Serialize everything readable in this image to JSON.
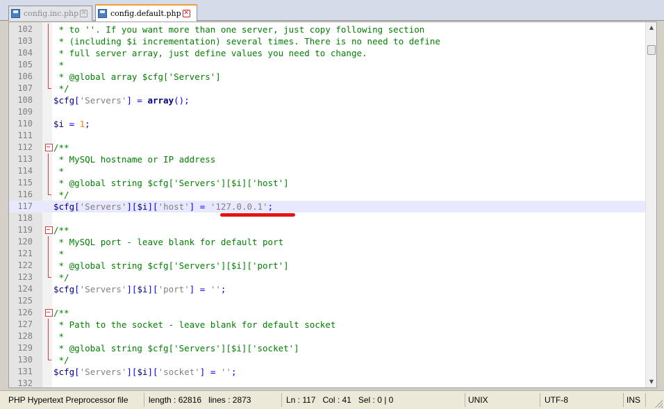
{
  "tabs": [
    {
      "label": "config.inc.php",
      "active": false
    },
    {
      "label": "config.default.php",
      "active": true
    }
  ],
  "editor": {
    "current_line": 117,
    "lines": [
      {
        "n": "102",
        "fold": "vline",
        "code": [
          [
            "c",
            " * to ''. If you want more than one server, just copy following section"
          ]
        ]
      },
      {
        "n": "103",
        "fold": "vline",
        "code": [
          [
            "c",
            " * (including $i incrementation) several times. There is no need to define"
          ]
        ]
      },
      {
        "n": "104",
        "fold": "vline",
        "code": [
          [
            "c",
            " * full server array, just define values you need to change."
          ]
        ]
      },
      {
        "n": "105",
        "fold": "vline",
        "code": [
          [
            "c",
            " *"
          ]
        ]
      },
      {
        "n": "106",
        "fold": "vline",
        "code": [
          [
            "c",
            " * @global array $cfg['Servers']"
          ]
        ]
      },
      {
        "n": "107",
        "fold": "end",
        "code": [
          [
            "c",
            " */"
          ]
        ]
      },
      {
        "n": "108",
        "fold": "",
        "code": [
          [
            "v",
            "$cfg"
          ],
          [
            "k",
            "["
          ],
          [
            "s",
            "'Servers'"
          ],
          [
            "k",
            "]"
          ],
          [
            "k",
            " = "
          ],
          [
            "kw",
            "array"
          ],
          [
            "k",
            "();"
          ]
        ]
      },
      {
        "n": "109",
        "fold": "",
        "code": []
      },
      {
        "n": "110",
        "fold": "",
        "code": [
          [
            "v",
            "$i"
          ],
          [
            "k",
            " = "
          ],
          [
            "n",
            "1"
          ],
          [
            "k",
            ";"
          ]
        ]
      },
      {
        "n": "111",
        "fold": "",
        "code": []
      },
      {
        "n": "112",
        "fold": "box",
        "code": [
          [
            "c",
            "/**"
          ]
        ]
      },
      {
        "n": "113",
        "fold": "vline",
        "code": [
          [
            "c",
            " * MySQL hostname or IP address"
          ]
        ]
      },
      {
        "n": "114",
        "fold": "vline",
        "code": [
          [
            "c",
            " *"
          ]
        ]
      },
      {
        "n": "115",
        "fold": "vline",
        "code": [
          [
            "c",
            " * @global string $cfg['Servers'][$i]['host']"
          ]
        ]
      },
      {
        "n": "116",
        "fold": "end",
        "code": [
          [
            "c",
            " */"
          ]
        ]
      },
      {
        "n": "117",
        "fold": "",
        "code": [
          [
            "v",
            "$cfg"
          ],
          [
            "k",
            "["
          ],
          [
            "s",
            "'Servers'"
          ],
          [
            "k",
            "]["
          ],
          [
            "v",
            "$i"
          ],
          [
            "k",
            "]["
          ],
          [
            "s",
            "'host'"
          ],
          [
            "k",
            "]"
          ],
          [
            "k",
            " = "
          ],
          [
            "s",
            "'127.0.0.1'"
          ],
          [
            "k",
            ";"
          ]
        ]
      },
      {
        "n": "118",
        "fold": "",
        "code": []
      },
      {
        "n": "119",
        "fold": "box",
        "code": [
          [
            "c",
            "/**"
          ]
        ]
      },
      {
        "n": "120",
        "fold": "vline",
        "code": [
          [
            "c",
            " * MySQL port - leave blank for default port"
          ]
        ]
      },
      {
        "n": "121",
        "fold": "vline",
        "code": [
          [
            "c",
            " *"
          ]
        ]
      },
      {
        "n": "122",
        "fold": "vline",
        "code": [
          [
            "c",
            " * @global string $cfg['Servers'][$i]['port']"
          ]
        ]
      },
      {
        "n": "123",
        "fold": "end",
        "code": [
          [
            "c",
            " */"
          ]
        ]
      },
      {
        "n": "124",
        "fold": "",
        "code": [
          [
            "v",
            "$cfg"
          ],
          [
            "k",
            "["
          ],
          [
            "s",
            "'Servers'"
          ],
          [
            "k",
            "]["
          ],
          [
            "v",
            "$i"
          ],
          [
            "k",
            "]["
          ],
          [
            "s",
            "'port'"
          ],
          [
            "k",
            "]"
          ],
          [
            "k",
            " = "
          ],
          [
            "s",
            "''"
          ],
          [
            "k",
            ";"
          ]
        ]
      },
      {
        "n": "125",
        "fold": "",
        "code": []
      },
      {
        "n": "126",
        "fold": "box",
        "code": [
          [
            "c",
            "/**"
          ]
        ]
      },
      {
        "n": "127",
        "fold": "vline",
        "code": [
          [
            "c",
            " * Path to the socket - leave blank for default socket"
          ]
        ]
      },
      {
        "n": "128",
        "fold": "vline",
        "code": [
          [
            "c",
            " *"
          ]
        ]
      },
      {
        "n": "129",
        "fold": "vline",
        "code": [
          [
            "c",
            " * @global string $cfg['Servers'][$i]['socket']"
          ]
        ]
      },
      {
        "n": "130",
        "fold": "end",
        "code": [
          [
            "c",
            " */"
          ]
        ]
      },
      {
        "n": "131",
        "fold": "",
        "code": [
          [
            "v",
            "$cfg"
          ],
          [
            "k",
            "["
          ],
          [
            "s",
            "'Servers'"
          ],
          [
            "k",
            "]["
          ],
          [
            "v",
            "$i"
          ],
          [
            "k",
            "]["
          ],
          [
            "s",
            "'socket'"
          ],
          [
            "k",
            "]"
          ],
          [
            "k",
            " = "
          ],
          [
            "s",
            "''"
          ],
          [
            "k",
            ";"
          ]
        ]
      },
      {
        "n": "132",
        "fold": "",
        "code": []
      }
    ]
  },
  "statusbar": {
    "file_type": "PHP Hypertext Preprocessor file",
    "length": "length : 62816",
    "lines": "lines : 2873",
    "ln": "Ln : 117",
    "col": "Col : 41",
    "sel": "Sel : 0 | 0",
    "eol": "UNIX",
    "encoding": "UTF-8",
    "mode": "INS"
  },
  "icons": {
    "tab_file": "file-icon",
    "tab_close": "close-icon",
    "scroll_up": "arrow-up-icon",
    "scroll_down": "arrow-down-icon",
    "fold_marker": "fold-minus-icon"
  },
  "colors": {
    "comment": "#008000",
    "string": "#808080",
    "variable": "#000080",
    "operator": "#0000ff",
    "number": "#ff8000",
    "current_line_bg": "#e8e8ff",
    "annotation_underline": "#e41515"
  }
}
